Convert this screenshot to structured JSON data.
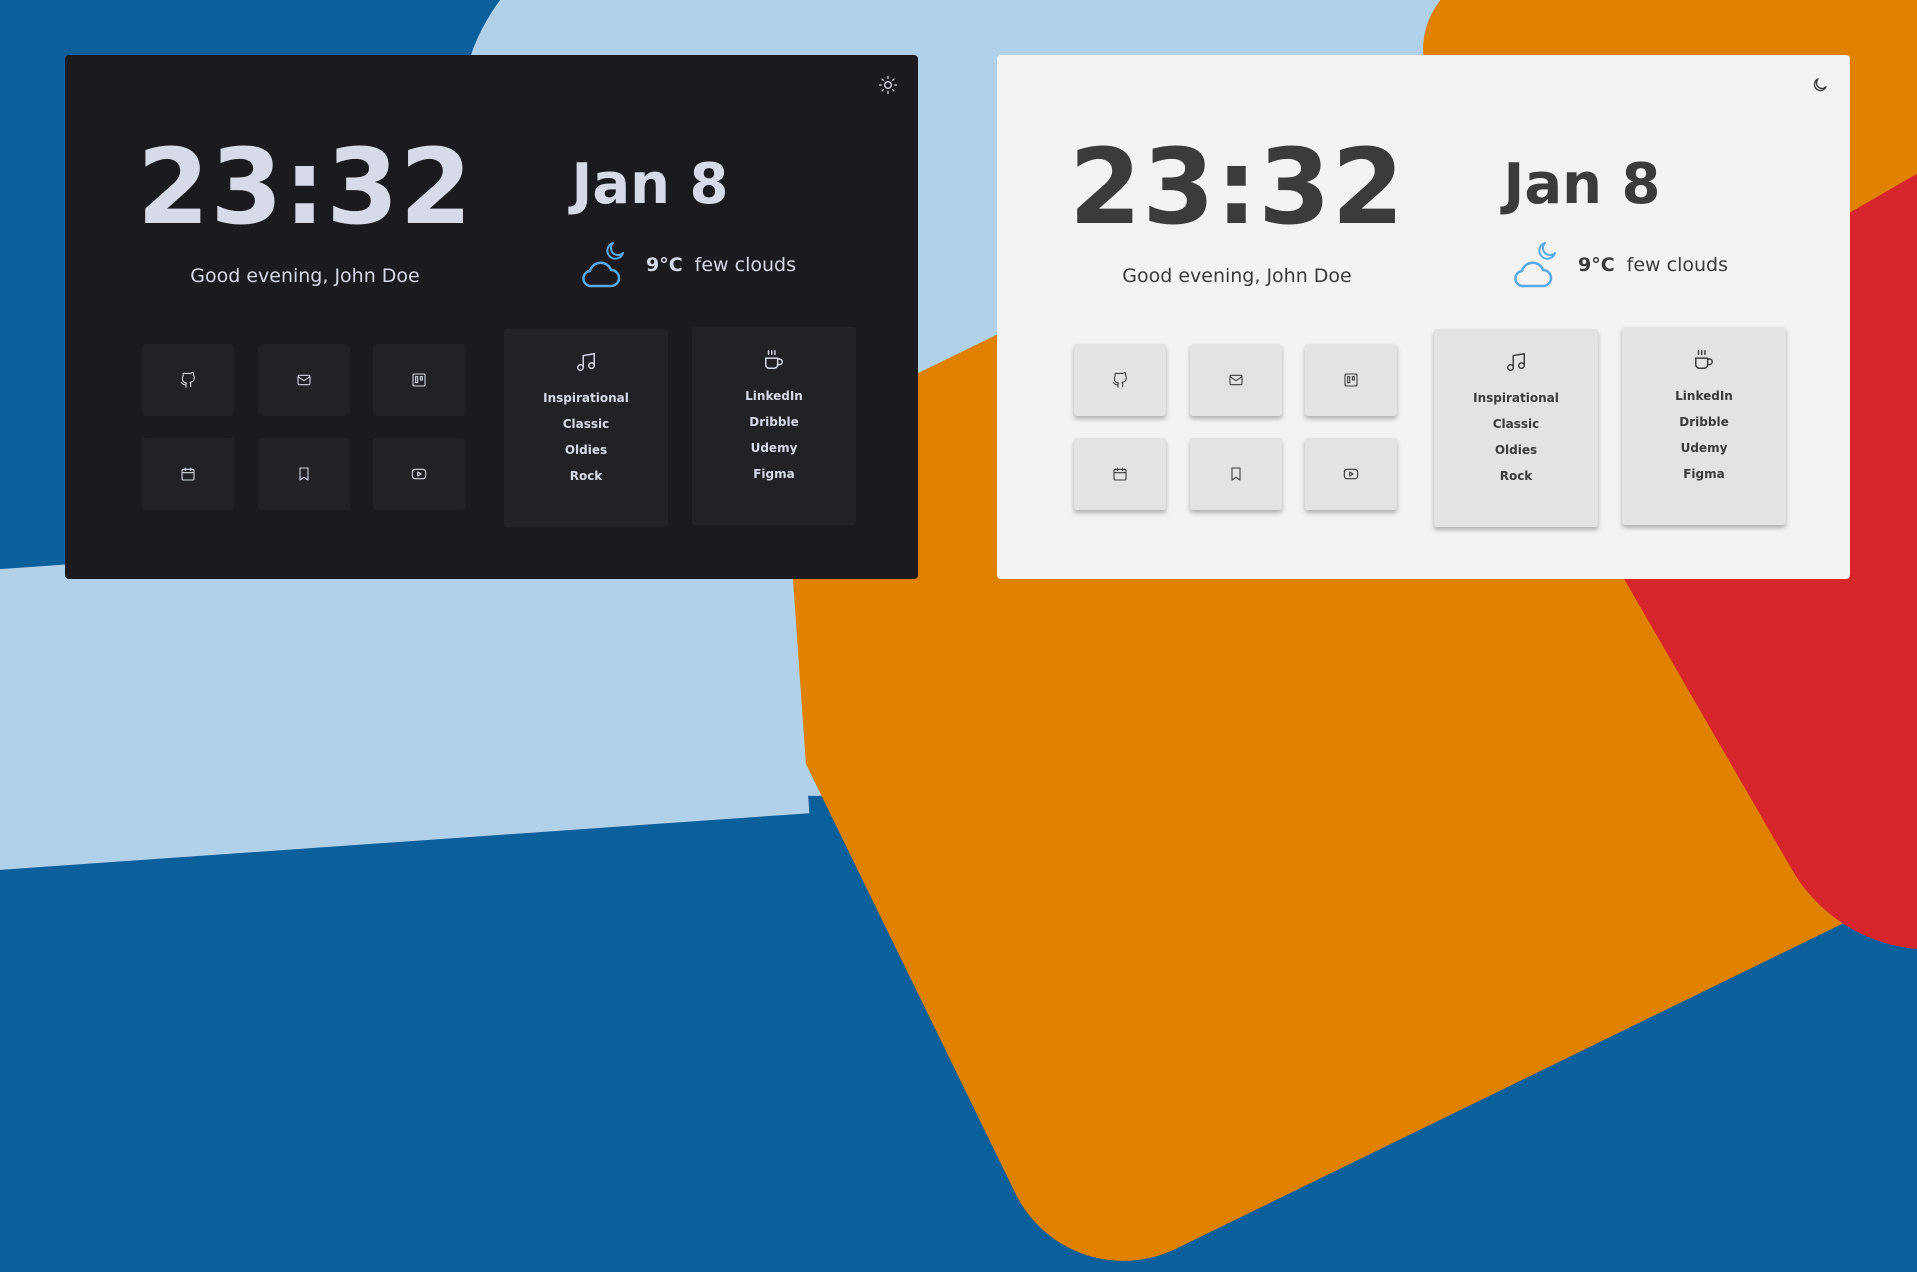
{
  "colors": {
    "dark_panel": "#1b1a1e",
    "light_panel": "#f3f3f3",
    "weather_icon": "#5aa8e6"
  },
  "panels": [
    {
      "theme": "dark",
      "toggle_icon": "sun-icon",
      "time": "23:32",
      "greeting": "Good evening, John Doe",
      "date": "Jan 8",
      "weather": {
        "icon": "cloud-moon-icon",
        "temp": "9°C",
        "desc": "few clouds"
      },
      "shortcuts": [
        "github-icon",
        "mail-icon",
        "trello-icon",
        "calendar-icon",
        "bookmark-icon",
        "youtube-icon"
      ],
      "music": {
        "icon": "music-note-icon",
        "items": [
          "Inspirational",
          "Classic",
          "Oldies",
          "Rock"
        ]
      },
      "links": {
        "icon": "coffee-cup-icon",
        "items": [
          "LinkedIn",
          "Dribble",
          "Udemy",
          "Figma"
        ]
      }
    },
    {
      "theme": "light",
      "toggle_icon": "moon-icon",
      "time": "23:32",
      "greeting": "Good evening, John Doe",
      "date": "Jan 8",
      "weather": {
        "icon": "cloud-moon-icon",
        "temp": "9°C",
        "desc": "few clouds"
      },
      "shortcuts": [
        "github-icon",
        "mail-icon",
        "trello-icon",
        "calendar-icon",
        "bookmark-icon",
        "youtube-icon"
      ],
      "music": {
        "icon": "music-note-icon",
        "items": [
          "Inspirational",
          "Classic",
          "Oldies",
          "Rock"
        ]
      },
      "links": {
        "icon": "coffee-cup-icon",
        "items": [
          "LinkedIn",
          "Dribble",
          "Udemy",
          "Figma"
        ]
      }
    }
  ]
}
